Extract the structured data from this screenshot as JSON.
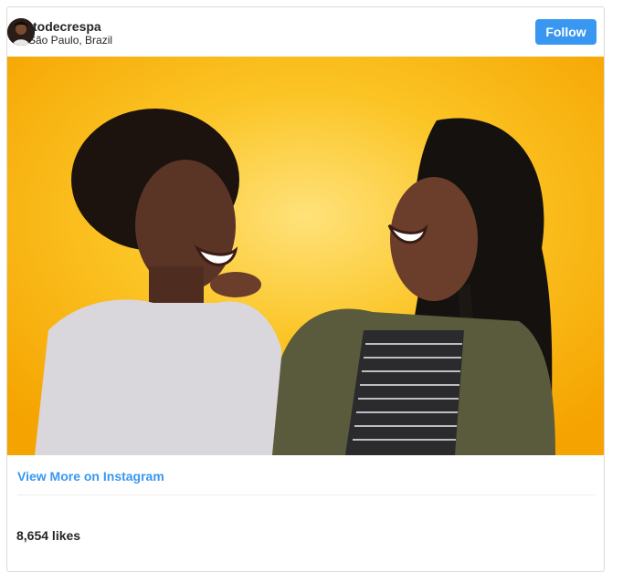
{
  "post": {
    "username": "todecrespa",
    "location": "São Paulo, Brazil",
    "follow_label": "Follow",
    "view_more_label": "View More on Instagram",
    "likes": "8,654 likes"
  },
  "colors": {
    "accent": "#3897f0",
    "text": "#262626",
    "background_yellow": "#f7b500"
  },
  "icons": {
    "avatar": "profile-avatar"
  }
}
